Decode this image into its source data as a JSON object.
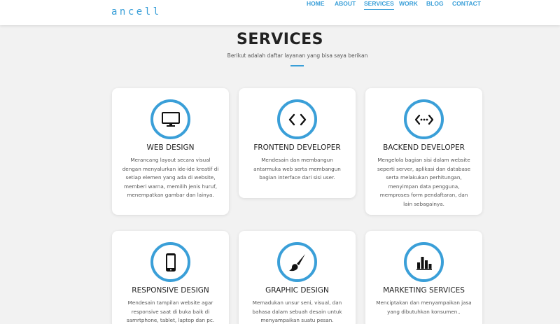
{
  "brand": "ancell",
  "nav": {
    "items": [
      {
        "label": "HOME",
        "active": false
      },
      {
        "label": "ABOUT",
        "active": false
      },
      {
        "label": "SERVICES",
        "active": true
      },
      {
        "label": "WORK",
        "active": false
      },
      {
        "label": "BLOG",
        "active": false
      },
      {
        "label": "CONTACT",
        "active": false
      }
    ]
  },
  "section": {
    "title": "SERVICES",
    "subtitle": "Berikut adalah daftar layanan yang bisa saya berikan"
  },
  "services": [
    {
      "icon": "monitor-icon",
      "title": "WEB DESIGN",
      "description": "Merancang layout secara visual dengan menyalurkan ide-ide kreatif di setiap elemen yang ada di website, memberi warna, memilih jenis huruf, menempatkan gambar dan lainya."
    },
    {
      "icon": "code-icon",
      "title": "FRONTEND DEVELOPER",
      "description": "Mendesain dan membangun antarmuka web serta membangun bagian interface dari sisi user."
    },
    {
      "icon": "code-dots-icon",
      "title": "BACKEND DEVELOPER",
      "description": "Mengelola bagian sisi dalam website seperti server, aplikasi dan database serta melakukan perhitungan, menyimpan data pengguna, memproses form pendaftaran, dan lain sebagainya."
    },
    {
      "icon": "smartphone-icon",
      "title": "RESPONSIVE DESIGN",
      "description": "Mendesain tampilan website agar responsive saat di buka baik di samrtphone, tablet, laptop dan pc."
    },
    {
      "icon": "paintbrush-icon",
      "title": "GRAPHIC DESIGN",
      "description": "Memadukan unsur seni, visual, dan bahasa dalam sebuah desain untuk menyampaikan suatu pesan."
    },
    {
      "icon": "bar-chart-icon",
      "title": "MARKETING SERVICES",
      "description": "Menciptakan dan menyampaikan jasa yang dibutuhkan konsumen.."
    }
  ],
  "colors": {
    "accent": "#3a9fd8",
    "background": "#f2f2f2",
    "card": "#ffffff"
  }
}
